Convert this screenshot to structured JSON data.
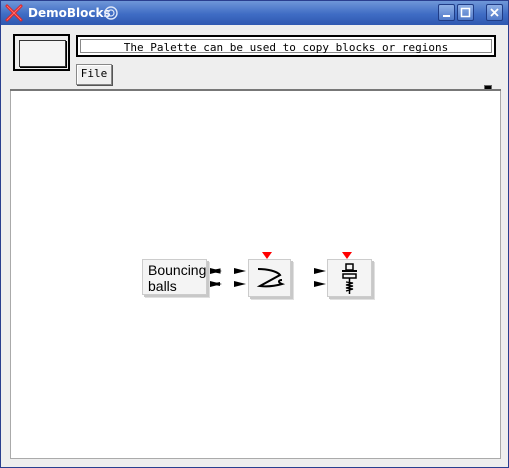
{
  "window": {
    "title": "DemoBlocks",
    "titlebar_color": "#3f6cc4",
    "app_icon": "red-x-icon",
    "controls": [
      "minimize",
      "maximize",
      "close"
    ]
  },
  "message_bar": {
    "text": "The Palette can be used to copy blocks or regions"
  },
  "menu": {
    "file_label": "File"
  },
  "diagram": {
    "blocks": [
      {
        "id": "bouncing-balls",
        "label": "Bouncing\nballs",
        "line1": "Bouncing",
        "line2": "balls",
        "icon": "text-block"
      },
      {
        "id": "scope",
        "icon": "curve-plot-icon",
        "marker_color": "#ff0000"
      },
      {
        "id": "sink",
        "icon": "spring-weight-icon",
        "marker_color": "#ff0000"
      }
    ]
  }
}
